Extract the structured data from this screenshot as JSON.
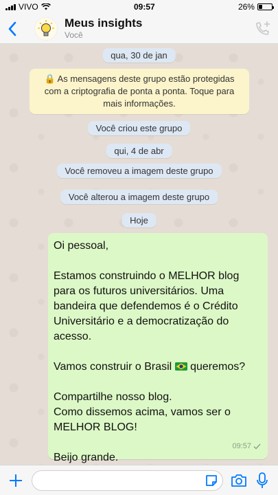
{
  "status_bar": {
    "carrier": "VIVO",
    "time": "09:57",
    "battery_text": "26%",
    "battery_level": 0.26
  },
  "header": {
    "back_icon": "chevron-left-icon",
    "avatar_icon": "lightbulb-icon",
    "group_name": "Meus insights",
    "subtitle": "Você",
    "call_icon": "add-call-icon"
  },
  "chat": {
    "date_1": "qua, 30 de jan",
    "encryption_notice": "🔒 As mensagens deste grupo estão protegidas com a criptografia de ponta a ponta. Toque para mais informações.",
    "event_1": "Você criou este grupo",
    "date_2": "qui, 4 de abr",
    "event_2": "Você removeu a imagem deste grupo",
    "event_3": "Você alterou a imagem deste grupo",
    "date_3": "Hoje",
    "message": {
      "line_1": "Oi pessoal,",
      "line_2": "Estamos construindo o MELHOR blog para os futuros universitários. Uma bandeira que defendemos é o Crédito Universitário e a democratização do acesso.",
      "line_3_before_flag": "Vamos construir o Brasil",
      "line_3_after_flag": "queremos?",
      "line_4": "Compartilhe nosso blog.",
      "line_5": "Como dissemos acima, vamos ser o MELHOR BLOG!",
      "line_6": "Beijo grande.",
      "time": "09:57",
      "status_icon": "check-icon"
    }
  },
  "input_bar": {
    "placeholder": "",
    "add_icon": "plus-icon",
    "sticker_icon": "sticker-icon",
    "camera_icon": "camera-icon",
    "mic_icon": "microphone-icon"
  },
  "colors": {
    "accent": "#007aff",
    "bubble_outgoing": "#dcf8c6",
    "system_pill": "#dde8f4",
    "encryption_bg": "#fcf4cb",
    "chat_bg": "#e5ddd5"
  }
}
